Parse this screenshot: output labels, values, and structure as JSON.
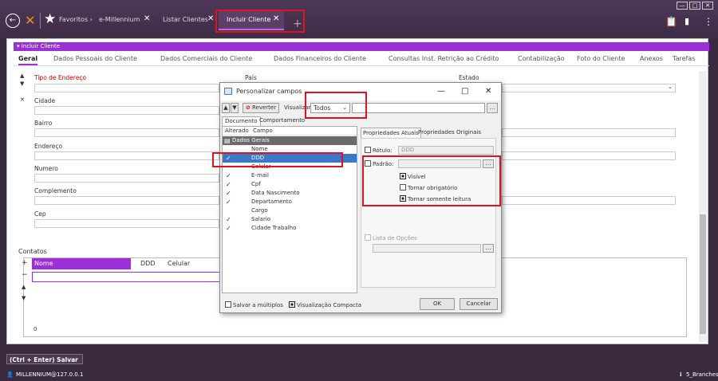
{
  "titlebar": {
    "tabs": [
      "Favoritos ›",
      "e-Millennium",
      "Listar Clientes",
      "Incluir Cliente"
    ],
    "close_glyph": "✕",
    "plus": "+",
    "logo_icon": "millennium-logo-icon",
    "accent": "#9b30d9"
  },
  "section": {
    "title": "▾ Incluir Cliente"
  },
  "tabs": [
    "Geral",
    "Dados Pessoais do Cliente",
    "Dados Comerciais do Cliente",
    "Dados Financeiros do Cliente",
    "Consultas Inst. Retrição ao Crédito",
    "Contabilização",
    "Foto do Cliente",
    "Anexos",
    "Tarefas"
  ],
  "form": {
    "tipo_endereco": "Tipo de Endereço",
    "pais": "País",
    "estado": "Estado",
    "cidade": "Cidade",
    "bairro": "Bairro",
    "endereco": "Endereço",
    "numero": "Numero",
    "complemento": "Complemento",
    "cep": "Cep"
  },
  "contatos": {
    "title": "Contatos",
    "columns": [
      "Nome",
      "DDD",
      "Celular"
    ],
    "count": "0"
  },
  "save": {
    "label": "(Ctrl + Enter) Salvar"
  },
  "status": {
    "user": "MILLENNIUM@127.0.0.1",
    "branch": "5_Branches"
  },
  "dialog": {
    "title": "Personalizar campos",
    "reverter": "Reverter",
    "visualizar": "Visualizar",
    "visualizar_value": "Todos",
    "tabs": [
      "Documento",
      "Comportamento"
    ],
    "tree_headers": [
      "Alterado",
      "Campo"
    ],
    "group": "Dados Gerais",
    "fields": [
      {
        "name": "Nome",
        "checked": false
      },
      {
        "name": "DDD",
        "checked": true
      },
      {
        "name": "Celular",
        "checked": false
      },
      {
        "name": "E-mail",
        "checked": true
      },
      {
        "name": "Cpf",
        "checked": true
      },
      {
        "name": "Data Nascimento",
        "checked": true
      },
      {
        "name": "Departamento",
        "checked": true
      },
      {
        "name": "Cargo",
        "checked": false
      },
      {
        "name": "Salario",
        "checked": true
      },
      {
        "name": "Cidade Trabalho",
        "checked": true
      }
    ],
    "prop_tabs": [
      "Propriedades Atuais",
      "Propriedades Originais"
    ],
    "rotulo_label": "Rótulo:",
    "rotulo_value": "DDD",
    "padrao_label": "Padrão:",
    "visivel": "Visível",
    "obrigatorio": "Tornar obrigatório",
    "leitura": "Tornar somente leitura",
    "lista_opcoes": "Lista de Opções",
    "salvar_multiplos": "Salvar a múltiplos",
    "vis_compacta": "Visualização Compacta",
    "ok": "OK",
    "cancelar": "Cancelar"
  }
}
